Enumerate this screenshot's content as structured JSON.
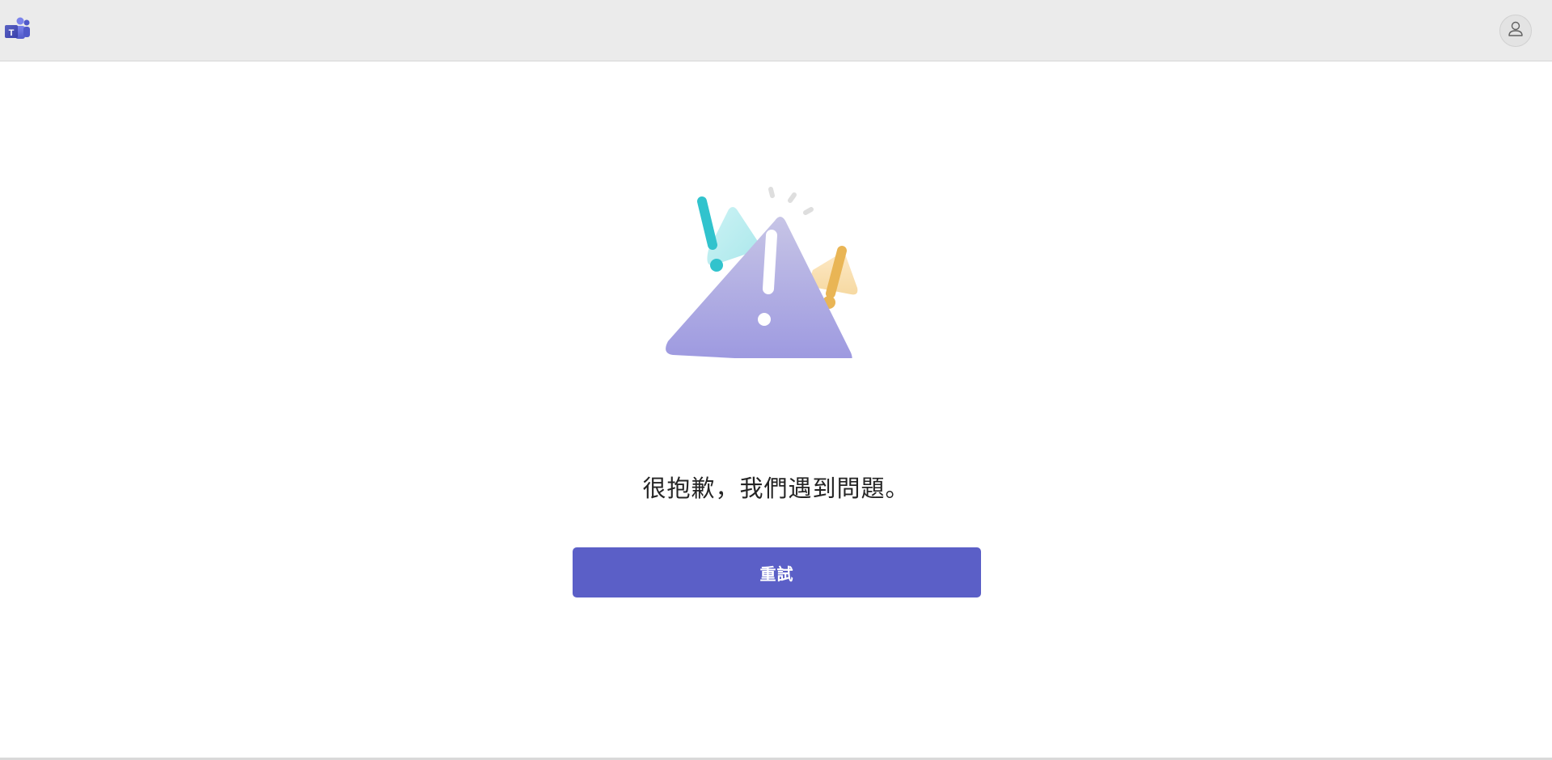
{
  "header": {
    "logo_icon": "microsoft-teams-icon",
    "account_icon": "person-icon",
    "background_color": "#ebebeb"
  },
  "main": {
    "illustration_icon": "warning-triangles-illustration",
    "error_message": "很抱歉，我們遇到問題。",
    "retry_label": "重試"
  },
  "colors": {
    "accent": "#5b5fc7",
    "warning_main": "#a9a6e0",
    "warning_teal": "#2fc4cf",
    "warning_orange": "#e9b555"
  }
}
